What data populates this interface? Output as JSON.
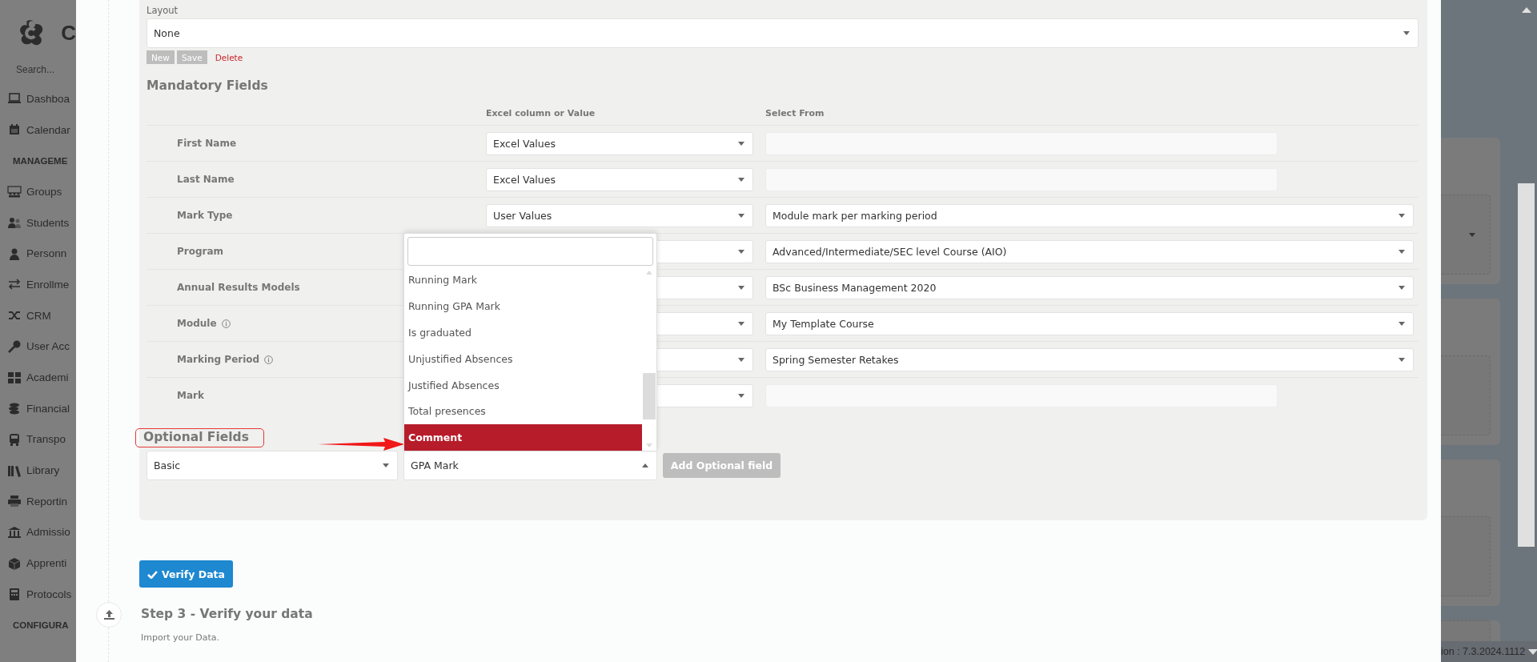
{
  "sidebar": {
    "logo_text": "C",
    "search_placeholder": "Search...",
    "items": [
      {
        "label": "Dashboa",
        "kind": "item"
      },
      {
        "label": "Calendar",
        "kind": "item"
      },
      {
        "label": "MANAGEME",
        "kind": "header"
      },
      {
        "label": "Groups",
        "kind": "item"
      },
      {
        "label": "Students",
        "kind": "item"
      },
      {
        "label": "Personn",
        "kind": "item"
      },
      {
        "label": "Enrollme",
        "kind": "item"
      },
      {
        "label": "CRM",
        "kind": "item"
      },
      {
        "label": "User Acc",
        "kind": "item"
      },
      {
        "label": "Academi",
        "kind": "item"
      },
      {
        "label": "Financial",
        "kind": "item"
      },
      {
        "label": "Transpo",
        "kind": "item"
      },
      {
        "label": "Library",
        "kind": "item"
      },
      {
        "label": "Reportin",
        "kind": "item"
      },
      {
        "label": "Admissio",
        "kind": "item"
      },
      {
        "label": "Apprenti",
        "kind": "item"
      },
      {
        "label": "Protocols",
        "kind": "item"
      },
      {
        "label": "CONFIGURA",
        "kind": "header"
      }
    ]
  },
  "form": {
    "layout": {
      "label": "Layout",
      "value": "None",
      "buttons": [
        {
          "label": "New",
          "kind": "plain"
        },
        {
          "label": "Save",
          "kind": "plain"
        },
        {
          "label": "Delete",
          "kind": "danger"
        }
      ]
    },
    "mandatory": {
      "title": "Mandatory Fields",
      "columns": [
        "Excel column or Value",
        "Select From"
      ],
      "rows": [
        {
          "label": "First Name",
          "info": false,
          "source": "Excel Values",
          "select_from": {
            "kind": "blank"
          }
        },
        {
          "label": "Last Name",
          "info": false,
          "source": "Excel Values",
          "select_from": {
            "kind": "blank"
          }
        },
        {
          "label": "Mark Type",
          "info": false,
          "source": "User Values",
          "select_from": {
            "kind": "select",
            "value": "Module mark per marking period"
          }
        },
        {
          "label": "Program",
          "info": false,
          "select_from": {
            "kind": "select",
            "value": "Advanced/Intermediate/SEC level Course (AIO)"
          }
        },
        {
          "label": "Annual Results Models",
          "info": false,
          "select_from": {
            "kind": "select",
            "value": "BSc Business Management 2020"
          }
        },
        {
          "label": "Module",
          "info": true,
          "select_from": {
            "kind": "select",
            "value": "My Template Course"
          }
        },
        {
          "label": "Marking Period",
          "info": true,
          "select_from": {
            "kind": "select",
            "value": "Spring Semester Retakes"
          }
        },
        {
          "label": "Mark",
          "info": false,
          "select_from": {
            "kind": "blank"
          }
        }
      ]
    },
    "optional": {
      "title": "Optional Fields",
      "highlighted": true,
      "pointer_arrow": true,
      "group": "Basic",
      "field": "GPA Mark",
      "field_open": true,
      "add_button": "Add Optional field",
      "dropdown_options": [
        {
          "label": "Running Mark",
          "selected": false
        },
        {
          "label": "Running GPA Mark",
          "selected": false
        },
        {
          "label": "Is graduated",
          "selected": false
        },
        {
          "label": "Unjustified Absences",
          "selected": false
        },
        {
          "label": "Justified Absences",
          "selected": false
        },
        {
          "label": "Total presences",
          "selected": false
        },
        {
          "label": "Comment",
          "selected": true
        }
      ]
    },
    "verify_button": "Verify Data",
    "step": {
      "title": "Step 3 - Verify your data",
      "text": "Import your Data."
    }
  },
  "footer": {
    "version": "ion : 7.3.2024.1112"
  }
}
